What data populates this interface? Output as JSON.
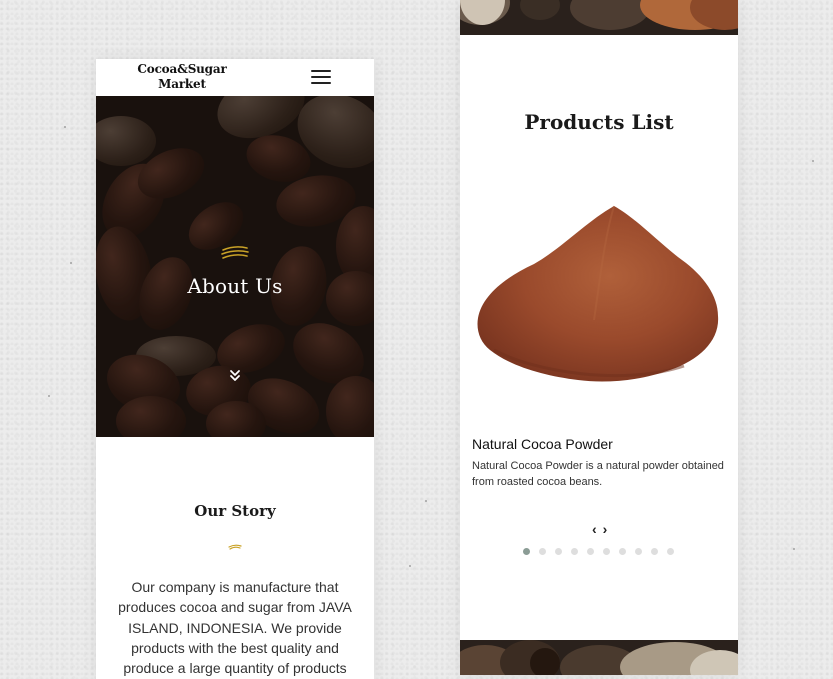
{
  "left_screen": {
    "logo": {
      "line1": "Cocoa&Sugar",
      "line2": "Market"
    },
    "hero": {
      "title": "About Us"
    },
    "story": {
      "title": "Our Story",
      "text": "Our company is manufacture that produces cocoa and sugar from JAVA ISLAND, INDONESIA. We provide products with the best quality and produce a large quantity of products"
    }
  },
  "right_screen": {
    "title": "Products List",
    "product": {
      "name": "Natural Cocoa Powder",
      "description": "Natural Cocoa Powder is a natural powder obtained from roasted cocoa beans."
    },
    "carousel": {
      "prev": "‹",
      "next": "›",
      "page_count": 10,
      "active_page": 1
    }
  },
  "colors": {
    "accent_gold": "#c9a227",
    "powder": "#9a4a2c",
    "active_dot": "#8b9c95",
    "inactive_dot": "#dedede"
  },
  "icons": [
    "hamburger-menu-icon",
    "wheat-emblem-icon",
    "double-chevron-down-icon",
    "arrow-left-icon",
    "arrow-right-icon"
  ]
}
